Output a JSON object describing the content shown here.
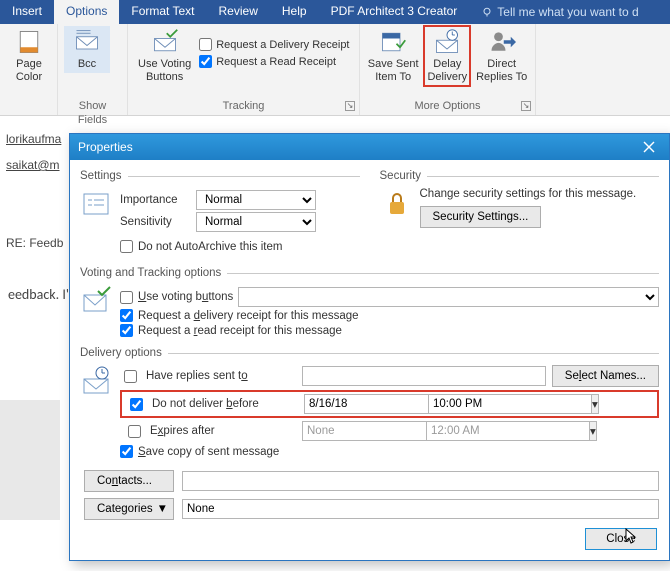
{
  "tabs": {
    "insert": "Insert",
    "options": "Options",
    "format": "Format Text",
    "review": "Review",
    "help": "Help",
    "pdf": "PDF Architect 3 Creator",
    "tellme": "Tell me what you want to d"
  },
  "ribbon": {
    "themes": {
      "pageColor": "Page\nColor",
      "label": ""
    },
    "showFields": {
      "bcc": "Bcc",
      "label": "Show Fields"
    },
    "tracking": {
      "voting": "Use Voting\nButtons",
      "deliveryReceipt": "Request a Delivery Receipt",
      "readReceipt": "Request a Read Receipt",
      "label": "Tracking"
    },
    "more": {
      "saveSent": "Save Sent\nItem To",
      "delay": "Delay\nDelivery",
      "direct": "Direct\nReplies To",
      "label": "More Options"
    }
  },
  "compose": {
    "from": "lorikaufma",
    "to": "saikat@m",
    "subject": "RE: Feedb",
    "body1": "eedback. I'"
  },
  "dialog": {
    "title": "Properties",
    "settings": {
      "legend": "Settings",
      "importanceLbl": "Importance",
      "importanceVal": "Normal",
      "sensitivityLbl": "Sensitivity",
      "sensitivityVal": "Normal",
      "noArchive": "Do not AutoArchive this item"
    },
    "security": {
      "legend": "Security",
      "desc": "Change security settings for this message.",
      "btn": "Security Settings..."
    },
    "voting": {
      "legend": "Voting and Tracking options",
      "useVoting": "Use voting buttons",
      "deliveryReceipt": "Request a delivery receipt for this message",
      "readReceipt": "Request a read receipt for this message"
    },
    "delivery": {
      "legend": "Delivery options",
      "haveReplies": "Have replies sent to",
      "selectNames": "Select Names...",
      "doNotBefore": "Do not deliver before",
      "date": "8/16/18",
      "time": "10:00 PM",
      "expires": "Expires after",
      "expDate": "None",
      "expTime": "12:00 AM",
      "saveCopy": "Save copy of sent message",
      "contacts": "Contacts...",
      "categories": "Categories",
      "catValue": "None"
    },
    "close": "Close"
  }
}
